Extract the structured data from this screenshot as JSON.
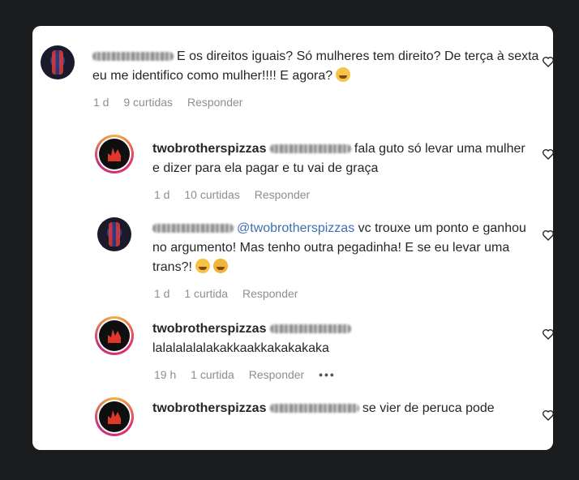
{
  "comments": [
    {
      "username_blurred": true,
      "text": "E os direitos iguais? Só mulheres tem direito? De terça à sexta eu me identifico como mulher!!!! E agora?",
      "time": "1 d",
      "likes": "9 curtidas",
      "reply": "Responder"
    },
    {
      "username": "twobrotherspizzas",
      "text": "fala guto só levar uma mulher e dizer para ela pagar e tu vai de graça",
      "time": "1 d",
      "likes": "10 curtidas",
      "reply": "Responder"
    },
    {
      "username_blurred": true,
      "mention": "@twobrotherspizzas",
      "text": "vc trouxe um ponto e ganhou no argumento! Mas tenho outra pegadinha! E se eu levar uma trans?!",
      "time": "1 d",
      "likes": "1 curtida",
      "reply": "Responder"
    },
    {
      "username": "twobrotherspizzas",
      "text": "lalalalalalakakkaakkakakakaka",
      "time": "19 h",
      "likes": "1 curtida",
      "reply": "Responder",
      "more": "•••"
    },
    {
      "username": "twobrotherspizzas",
      "text": "se vier de peruca pode"
    }
  ],
  "icons": {
    "like": "heart-icon",
    "more": "more-options-icon",
    "emoji_1": "hugging-face-emoji",
    "emoji_2": "sweat-smile-emoji",
    "emoji_3": "rofl-emoji"
  }
}
